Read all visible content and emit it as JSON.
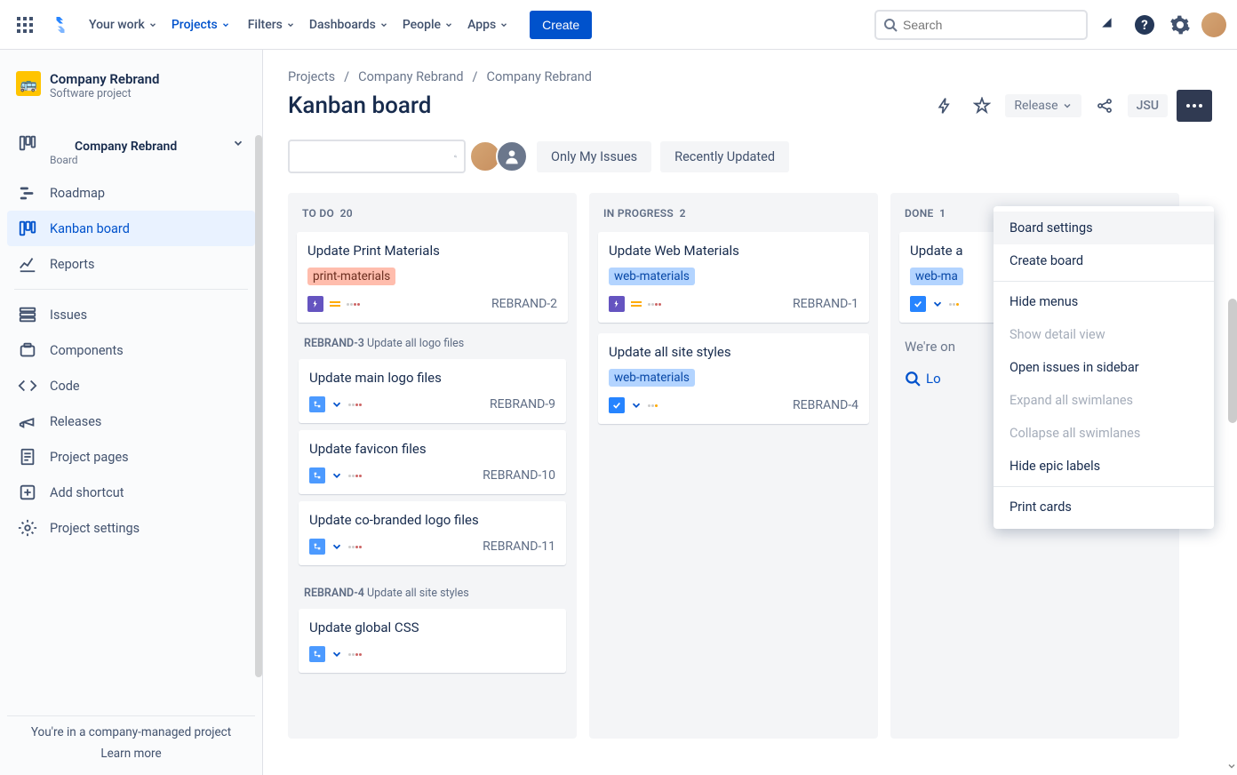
{
  "topnav": {
    "items": [
      "Your work",
      "Projects",
      "Filters",
      "Dashboards",
      "People",
      "Apps"
    ],
    "active_index": 1,
    "create": "Create",
    "search_placeholder": "Search"
  },
  "sidebar": {
    "project_name": "Company Rebrand",
    "project_type": "Software project",
    "board": {
      "name": "Company Rebrand",
      "sub": "Board"
    },
    "nav": [
      {
        "label": "Roadmap",
        "icon": "roadmap"
      },
      {
        "label": "Kanban board",
        "icon": "board",
        "selected": true
      },
      {
        "label": "Reports",
        "icon": "reports"
      }
    ],
    "nav2": [
      {
        "label": "Issues",
        "icon": "issues"
      },
      {
        "label": "Components",
        "icon": "components"
      },
      {
        "label": "Code",
        "icon": "code"
      },
      {
        "label": "Releases",
        "icon": "releases"
      },
      {
        "label": "Project pages",
        "icon": "pages"
      },
      {
        "label": "Add shortcut",
        "icon": "shortcut"
      },
      {
        "label": "Project settings",
        "icon": "settings"
      }
    ],
    "footer_text": "You're in a company-managed project",
    "footer_link": "Learn more"
  },
  "breadcrumb": [
    "Projects",
    "Company Rebrand",
    "Company Rebrand"
  ],
  "page_title": "Kanban board",
  "head_actions": {
    "release": "Release",
    "jsu": "JSU"
  },
  "filters": {
    "only_my": "Only My Issues",
    "recent": "Recently Updated"
  },
  "columns": [
    {
      "title": "TO DO",
      "count": 20,
      "cards": [
        {
          "title": "Update Print Materials",
          "tag": "print-materials",
          "tag_type": "print",
          "type": "epic",
          "prio": "med",
          "key": "REBRAND-2"
        }
      ],
      "groups": [
        {
          "parent_key": "REBRAND-3",
          "parent_title": "Update all logo files",
          "cards": [
            {
              "title": "Update main logo files",
              "type": "sub",
              "key": "REBRAND-9"
            },
            {
              "title": "Update favicon files",
              "type": "sub",
              "key": "REBRAND-10"
            },
            {
              "title": "Update co-branded logo files",
              "type": "sub",
              "key": "REBRAND-11"
            }
          ]
        },
        {
          "parent_key": "REBRAND-4",
          "parent_title": "Update all site styles",
          "cards": [
            {
              "title": "Update global CSS",
              "type": "sub",
              "key": ""
            }
          ]
        }
      ]
    },
    {
      "title": "IN PROGRESS",
      "count": 2,
      "cards": [
        {
          "title": "Update Web Materials",
          "tag": "web-materials",
          "tag_type": "web",
          "type": "epic",
          "prio": "med",
          "key": "REBRAND-1"
        },
        {
          "title": "Update all site styles",
          "tag": "web-materials",
          "tag_type": "web",
          "type": "task",
          "prio": "low",
          "key": "REBRAND-4"
        }
      ],
      "groups": []
    },
    {
      "title": "DONE",
      "count": 1,
      "cards": [
        {
          "title": "Update a",
          "tag": "web-ma",
          "tag_type": "web",
          "type": "task",
          "key": ""
        }
      ],
      "done_message": "We're on",
      "done_link": "Lo",
      "groups": []
    }
  ],
  "dropdown": [
    {
      "label": "Board settings",
      "state": "highlighted"
    },
    {
      "label": "Create board"
    },
    {
      "sep": true
    },
    {
      "label": "Hide menus"
    },
    {
      "label": "Show detail view",
      "state": "disabled"
    },
    {
      "label": "Open issues in sidebar"
    },
    {
      "label": "Expand all swimlanes",
      "state": "disabled"
    },
    {
      "label": "Collapse all swimlanes",
      "state": "disabled"
    },
    {
      "label": "Hide epic labels"
    },
    {
      "sep": true
    },
    {
      "label": "Print cards"
    }
  ]
}
